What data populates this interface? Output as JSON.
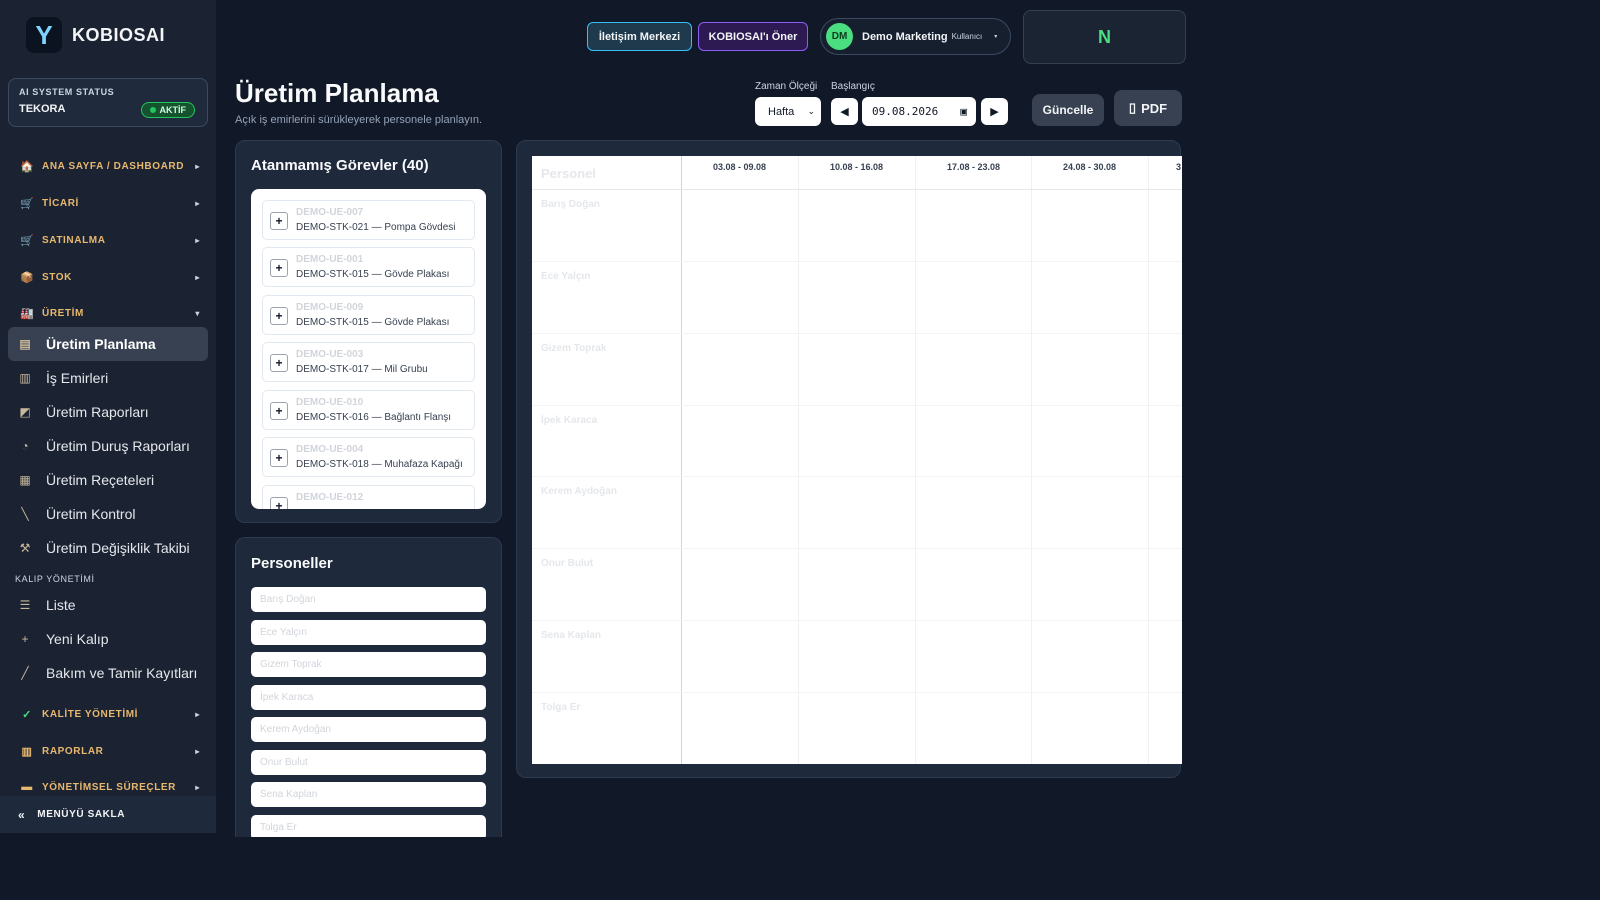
{
  "brand": {
    "logo_letter": "Y",
    "name": "KOBIOSAI"
  },
  "ai_status": {
    "label": "AI SYSTEM STATUS",
    "name": "TEKORA",
    "badge": "AKTİF"
  },
  "sidebar": {
    "sections": [
      {
        "label": "ANA SAYFA / DASHBOARD",
        "icon": "home-icon",
        "glyph": "🏠",
        "arrow": "▸"
      },
      {
        "label": "TİCARİ",
        "icon": "register-icon",
        "glyph": "🛒",
        "arrow": "▸"
      },
      {
        "label": "SATINALMA",
        "icon": "cart-icon",
        "glyph": "🛒",
        "arrow": "▸"
      },
      {
        "label": "STOK",
        "icon": "box-icon",
        "glyph": "📦",
        "arrow": "▸"
      },
      {
        "label": "ÜRETİM",
        "icon": "factory-icon",
        "glyph": "🏭",
        "arrow": "▾"
      }
    ],
    "production_items": [
      {
        "label": "Üretim Planlama",
        "icon": "calendar-icon",
        "glyph": "▤"
      },
      {
        "label": "İş Emirleri",
        "icon": "factory-icon",
        "glyph": "▥"
      },
      {
        "label": "Üretim Raporları",
        "icon": "chart-icon",
        "glyph": "◩"
      },
      {
        "label": "Üretim Duruş Raporları",
        "icon": "stopwatch-icon",
        "glyph": "◔"
      },
      {
        "label": "Üretim Reçeteleri",
        "icon": "clipboard-icon",
        "glyph": "▦"
      },
      {
        "label": "Üretim Kontrol",
        "icon": "ruler-icon",
        "glyph": "╲"
      },
      {
        "label": "Üretim Değişiklik Takibi",
        "icon": "tools-icon",
        "glyph": "⚒"
      }
    ],
    "mold_heading": "KALIP YÖNETİMİ",
    "mold_items": [
      {
        "label": "Liste",
        "icon": "stack-icon",
        "glyph": "☰"
      },
      {
        "label": "Yeni Kalıp",
        "icon": "plus-icon",
        "glyph": "+"
      },
      {
        "label": "Bakım ve Tamir Kayıtları",
        "icon": "wrench-icon",
        "glyph": "╱"
      }
    ],
    "bottom_sections": [
      {
        "label": "KALİTE YÖNETİMİ",
        "icon": "check-icon",
        "glyph": "✓",
        "arrow": "▸"
      },
      {
        "label": "RAPORLAR",
        "icon": "bar-chart-icon",
        "glyph": "▥",
        "arrow": "▸"
      },
      {
        "label": "YÖNETİMSEL SÜREÇLER",
        "icon": "folder-icon",
        "glyph": "▬",
        "arrow": "▸"
      }
    ],
    "hide_menu": {
      "label": "MENÜYÜ SAKLA",
      "icon": "double-chevron-left-icon",
      "glyph": "«"
    }
  },
  "topbar": {
    "contact_button": "İletişim Merkezi",
    "recommend_button": "KOBIOSAI'ı Öner",
    "user": {
      "initials": "DM",
      "name": "Demo Marketing",
      "role": "Kullanıcı",
      "caret": "▾"
    },
    "n_box": "N"
  },
  "page": {
    "title": "Üretim Planlama",
    "subtitle": "Açık iş emirlerini sürükleyerek personele planlayın."
  },
  "controls": {
    "scale_label": "Zaman Ölçeği",
    "scale_value": "Hafta",
    "start_label": "Başlangıç",
    "start_value": "09.08.2026",
    "prev_glyph": "◀",
    "next_glyph": "▶",
    "update_button": "Güncelle",
    "pdf_button": "PDF"
  },
  "tasks": {
    "title": "Atanmamış Görevler (40)",
    "items": [
      {
        "code": "DEMO-UE-007",
        "desc": "DEMO-STK-021 — Pompa Gövdesi"
      },
      {
        "code": "DEMO-UE-001",
        "desc": "DEMO-STK-015 — Gövde Plakası"
      },
      {
        "code": "DEMO-UE-009",
        "desc": "DEMO-STK-015 — Gövde Plakası"
      },
      {
        "code": "DEMO-UE-003",
        "desc": "DEMO-STK-017 — Mil Grubu"
      },
      {
        "code": "DEMO-UE-010",
        "desc": "DEMO-STK-016 — Bağlantı Flanşı"
      },
      {
        "code": "DEMO-UE-004",
        "desc": "DEMO-STK-018 — Muhafaza Kapağı"
      },
      {
        "code": "DEMO-UE-012",
        "desc": ""
      }
    ]
  },
  "personnel": {
    "title": "Personeller",
    "names": [
      "Barış Doğan",
      "Ece Yalçın",
      "Gizem Toprak",
      "İpek Karaca",
      "Kerem Aydoğan",
      "Onur Bulut",
      "Sena Kaplan",
      "Tolga Er"
    ]
  },
  "schedule": {
    "person_header": "Personel",
    "weeks": [
      "03.08 - 09.08",
      "10.08 - 16.08",
      "17.08 - 23.08",
      "24.08 - 30.08",
      "3"
    ],
    "rows": [
      "Barış Doğan",
      "Ece Yalçın",
      "Gizem Toprak",
      "İpek Karaca",
      "Kerem Aydoğan",
      "Onur Bulut",
      "Sena Kaplan",
      "Tolga Er"
    ]
  }
}
